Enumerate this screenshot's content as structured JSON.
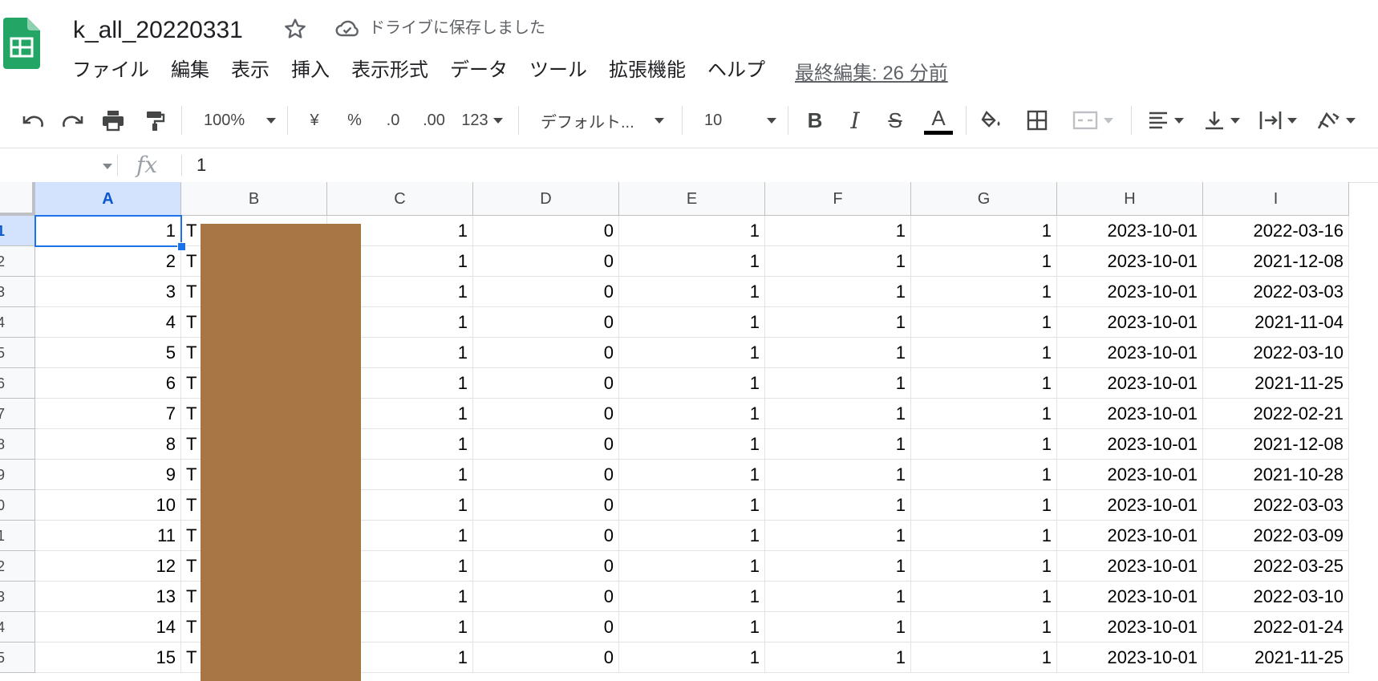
{
  "app": {
    "doc_title": "k_all_20220331",
    "save_status": "ドライブに保存しました",
    "star_icon": "star-outline-icon",
    "cloud_icon": "cloud-check-icon",
    "logo": "google-sheets-logo"
  },
  "menu": {
    "items": [
      "ファイル",
      "編集",
      "表示",
      "挿入",
      "表示形式",
      "データ",
      "ツール",
      "拡張機能",
      "ヘルプ"
    ],
    "last_edit": "最終編集: 26 分前"
  },
  "toolbar": {
    "zoom": "100%",
    "currency": "¥",
    "percent": "%",
    "decrease_decimal": ".0",
    "increase_decimal": ".00",
    "more_formats": "123",
    "font": "デフォルト...",
    "font_size": "10",
    "bold": "B",
    "italic": "I",
    "strikethrough": "S",
    "text_color": "A",
    "text_color_value": "#000000"
  },
  "formula_bar": {
    "name_box": "",
    "fx": "fx",
    "value": "1"
  },
  "sheet": {
    "columns": [
      "A",
      "B",
      "C",
      "D",
      "E",
      "F",
      "G",
      "H",
      "I"
    ],
    "row_headers": [
      "1",
      "2",
      "3",
      "4",
      "5",
      "6",
      "7",
      "8",
      "9",
      "0",
      "1",
      "2",
      "3",
      "4",
      "5"
    ],
    "rows": [
      [
        "1",
        "T",
        "1",
        "0",
        "1",
        "1",
        "1",
        "2023-10-01",
        "2022-03-16"
      ],
      [
        "2",
        "T",
        "1",
        "0",
        "1",
        "1",
        "1",
        "2023-10-01",
        "2021-12-08"
      ],
      [
        "3",
        "T",
        "1",
        "0",
        "1",
        "1",
        "1",
        "2023-10-01",
        "2022-03-03"
      ],
      [
        "4",
        "T",
        "1",
        "0",
        "1",
        "1",
        "1",
        "2023-10-01",
        "2021-11-04"
      ],
      [
        "5",
        "T",
        "1",
        "0",
        "1",
        "1",
        "1",
        "2023-10-01",
        "2022-03-10"
      ],
      [
        "6",
        "T",
        "1",
        "0",
        "1",
        "1",
        "1",
        "2023-10-01",
        "2021-11-25"
      ],
      [
        "7",
        "T",
        "1",
        "0",
        "1",
        "1",
        "1",
        "2023-10-01",
        "2022-02-21"
      ],
      [
        "8",
        "T",
        "1",
        "0",
        "1",
        "1",
        "1",
        "2023-10-01",
        "2021-12-08"
      ],
      [
        "9",
        "T",
        "1",
        "0",
        "1",
        "1",
        "1",
        "2023-10-01",
        "2021-10-28"
      ],
      [
        "10",
        "T",
        "1",
        "0",
        "1",
        "1",
        "1",
        "2023-10-01",
        "2022-03-03"
      ],
      [
        "11",
        "T",
        "1",
        "0",
        "1",
        "1",
        "1",
        "2023-10-01",
        "2022-03-09"
      ],
      [
        "12",
        "T",
        "1",
        "0",
        "1",
        "1",
        "1",
        "2023-10-01",
        "2022-03-25"
      ],
      [
        "13",
        "T",
        "1",
        "0",
        "1",
        "1",
        "1",
        "2023-10-01",
        "2022-03-10"
      ],
      [
        "14",
        "T",
        "1",
        "0",
        "1",
        "1",
        "1",
        "2023-10-01",
        "2022-01-24"
      ],
      [
        "15",
        "T",
        "1",
        "0",
        "1",
        "1",
        "1",
        "2023-10-01",
        "2021-11-25"
      ]
    ],
    "selected_cell": "A1",
    "redaction_color": "#a87645"
  }
}
